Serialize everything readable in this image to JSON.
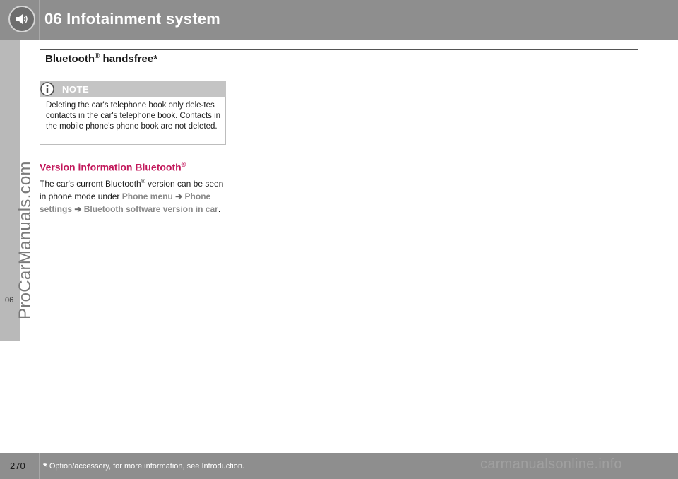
{
  "header": {
    "title": "06  Infotainment system",
    "icon": "speaker-icon"
  },
  "side_tab": {
    "label": "06"
  },
  "watermark_left": "ProCarManuals.com",
  "section": {
    "title_part1": "Bluetooth",
    "title_reg": "®",
    "title_part2": " handsfree*"
  },
  "note": {
    "label": "NOTE",
    "icon": "info-icon",
    "text": "Deleting the car's telephone book only dele-tes contacts in the car's telephone book. Contacts in the mobile phone's phone book are not deleted."
  },
  "subsection": {
    "title": "Version information Bluetooth",
    "title_reg": "®",
    "text_1": "The car's current Bluetooth",
    "text_reg": "®",
    "text_2": " version can be seen in phone mode under ",
    "menu_1": "Phone menu",
    "arrow": "➔",
    "menu_2": "Phone settings",
    "menu_3": "Bluetooth software version in car",
    "text_end": "."
  },
  "footer": {
    "page_number": "270",
    "star": "*",
    "footnote": "Option/accessory, for more information, see Introduction.",
    "watermark": "carmanualsonline.info"
  },
  "colors": {
    "header_bg": "#8e8e8e",
    "accent_red": "#c2185b",
    "menu_gray": "#8a8a8a"
  }
}
